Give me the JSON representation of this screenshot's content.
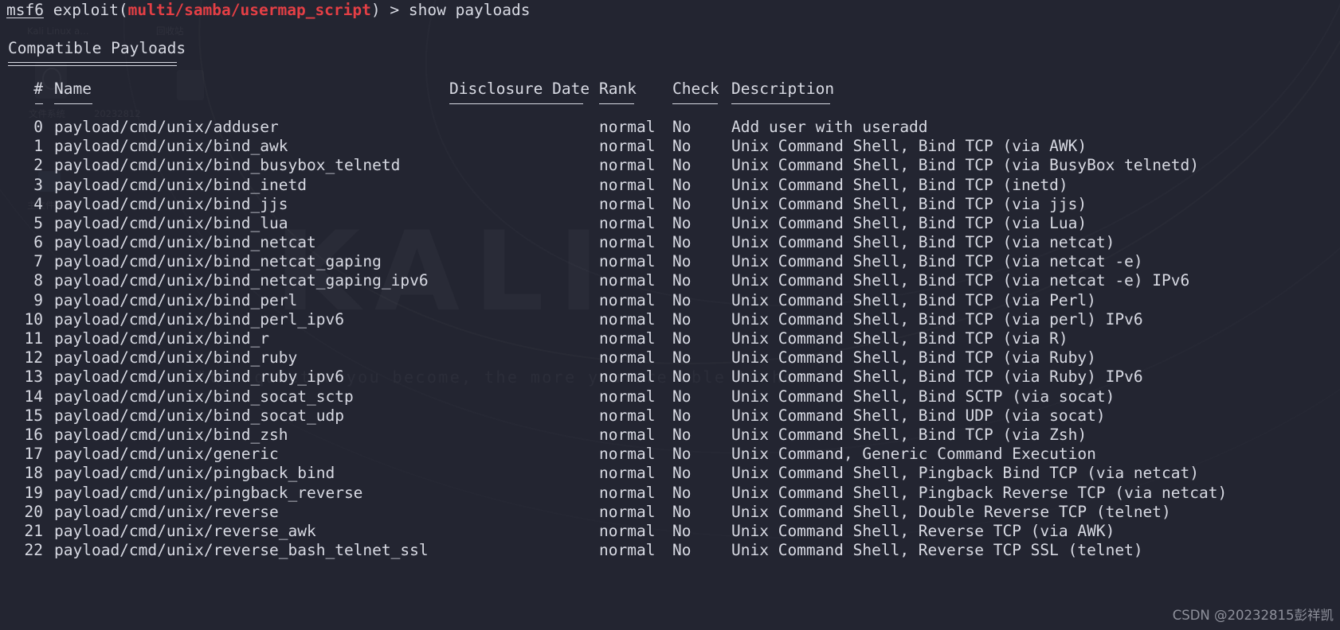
{
  "terminal": {
    "background_color": "#232531",
    "foreground_color": "#d8dae3",
    "accent_color": "#e43f45"
  },
  "prompt": {
    "shell": "msf6",
    "exploit_keyword": " exploit(",
    "module_path": "multi/samba/usermap_script",
    "close_paren": ")",
    "separator": " > ",
    "command": "show payloads"
  },
  "section": {
    "title": "Compatible Payloads"
  },
  "table": {
    "headers": {
      "index": "#",
      "name": "Name",
      "disclosure_date": "Disclosure Date",
      "rank": "Rank",
      "check": "Check",
      "description": "Description"
    },
    "rows": [
      {
        "index": "0",
        "name": "payload/cmd/unix/adduser",
        "disclosure_date": "",
        "rank": "normal",
        "check": "No",
        "description": "Add user with useradd"
      },
      {
        "index": "1",
        "name": "payload/cmd/unix/bind_awk",
        "disclosure_date": "",
        "rank": "normal",
        "check": "No",
        "description": "Unix Command Shell, Bind TCP (via AWK)"
      },
      {
        "index": "2",
        "name": "payload/cmd/unix/bind_busybox_telnetd",
        "disclosure_date": "",
        "rank": "normal",
        "check": "No",
        "description": "Unix Command Shell, Bind TCP (via BusyBox telnetd)"
      },
      {
        "index": "3",
        "name": "payload/cmd/unix/bind_inetd",
        "disclosure_date": "",
        "rank": "normal",
        "check": "No",
        "description": "Unix Command Shell, Bind TCP (inetd)"
      },
      {
        "index": "4",
        "name": "payload/cmd/unix/bind_jjs",
        "disclosure_date": "",
        "rank": "normal",
        "check": "No",
        "description": "Unix Command Shell, Bind TCP (via jjs)"
      },
      {
        "index": "5",
        "name": "payload/cmd/unix/bind_lua",
        "disclosure_date": "",
        "rank": "normal",
        "check": "No",
        "description": "Unix Command Shell, Bind TCP (via Lua)"
      },
      {
        "index": "6",
        "name": "payload/cmd/unix/bind_netcat",
        "disclosure_date": "",
        "rank": "normal",
        "check": "No",
        "description": "Unix Command Shell, Bind TCP (via netcat)"
      },
      {
        "index": "7",
        "name": "payload/cmd/unix/bind_netcat_gaping",
        "disclosure_date": "",
        "rank": "normal",
        "check": "No",
        "description": "Unix Command Shell, Bind TCP (via netcat -e)"
      },
      {
        "index": "8",
        "name": "payload/cmd/unix/bind_netcat_gaping_ipv6",
        "disclosure_date": "",
        "rank": "normal",
        "check": "No",
        "description": "Unix Command Shell, Bind TCP (via netcat -e) IPv6"
      },
      {
        "index": "9",
        "name": "payload/cmd/unix/bind_perl",
        "disclosure_date": "",
        "rank": "normal",
        "check": "No",
        "description": "Unix Command Shell, Bind TCP (via Perl)"
      },
      {
        "index": "10",
        "name": "payload/cmd/unix/bind_perl_ipv6",
        "disclosure_date": "",
        "rank": "normal",
        "check": "No",
        "description": "Unix Command Shell, Bind TCP (via perl) IPv6"
      },
      {
        "index": "11",
        "name": "payload/cmd/unix/bind_r",
        "disclosure_date": "",
        "rank": "normal",
        "check": "No",
        "description": "Unix Command Shell, Bind TCP (via R)"
      },
      {
        "index": "12",
        "name": "payload/cmd/unix/bind_ruby",
        "disclosure_date": "",
        "rank": "normal",
        "check": "No",
        "description": "Unix Command Shell, Bind TCP (via Ruby)"
      },
      {
        "index": "13",
        "name": "payload/cmd/unix/bind_ruby_ipv6",
        "disclosure_date": "",
        "rank": "normal",
        "check": "No",
        "description": "Unix Command Shell, Bind TCP (via Ruby) IPv6"
      },
      {
        "index": "14",
        "name": "payload/cmd/unix/bind_socat_sctp",
        "disclosure_date": "",
        "rank": "normal",
        "check": "No",
        "description": "Unix Command Shell, Bind SCTP (via socat)"
      },
      {
        "index": "15",
        "name": "payload/cmd/unix/bind_socat_udp",
        "disclosure_date": "",
        "rank": "normal",
        "check": "No",
        "description": "Unix Command Shell, Bind UDP (via socat)"
      },
      {
        "index": "16",
        "name": "payload/cmd/unix/bind_zsh",
        "disclosure_date": "",
        "rank": "normal",
        "check": "No",
        "description": "Unix Command Shell, Bind TCP (via Zsh)"
      },
      {
        "index": "17",
        "name": "payload/cmd/unix/generic",
        "disclosure_date": "",
        "rank": "normal",
        "check": "No",
        "description": "Unix Command, Generic Command Execution"
      },
      {
        "index": "18",
        "name": "payload/cmd/unix/pingback_bind",
        "disclosure_date": "",
        "rank": "normal",
        "check": "No",
        "description": "Unix Command Shell, Pingback Bind TCP (via netcat)"
      },
      {
        "index": "19",
        "name": "payload/cmd/unix/pingback_reverse",
        "disclosure_date": "",
        "rank": "normal",
        "check": "No",
        "description": "Unix Command Shell, Pingback Reverse TCP (via netcat)"
      },
      {
        "index": "20",
        "name": "payload/cmd/unix/reverse",
        "disclosure_date": "",
        "rank": "normal",
        "check": "No",
        "description": "Unix Command Shell, Double Reverse TCP (telnet)"
      },
      {
        "index": "21",
        "name": "payload/cmd/unix/reverse_awk",
        "disclosure_date": "",
        "rank": "normal",
        "check": "No",
        "description": "Unix Command Shell, Reverse TCP (via AWK)"
      },
      {
        "index": "22",
        "name": "payload/cmd/unix/reverse_bash_telnet_ssl",
        "disclosure_date": "",
        "rank": "normal",
        "check": "No",
        "description": "Unix Command Shell, Reverse TCP SSL (telnet)"
      }
    ]
  },
  "wallpaper": {
    "brand": "KALI",
    "tagline": "\"the quieter you become, the more you are able to hear\"",
    "desktop_labels": [
      "Kali Linux a…",
      "回收站",
      "文件系统",
      "20232812",
      "主文件夹"
    ]
  },
  "watermark": {
    "text": "CSDN @20232815彭祥凯"
  }
}
